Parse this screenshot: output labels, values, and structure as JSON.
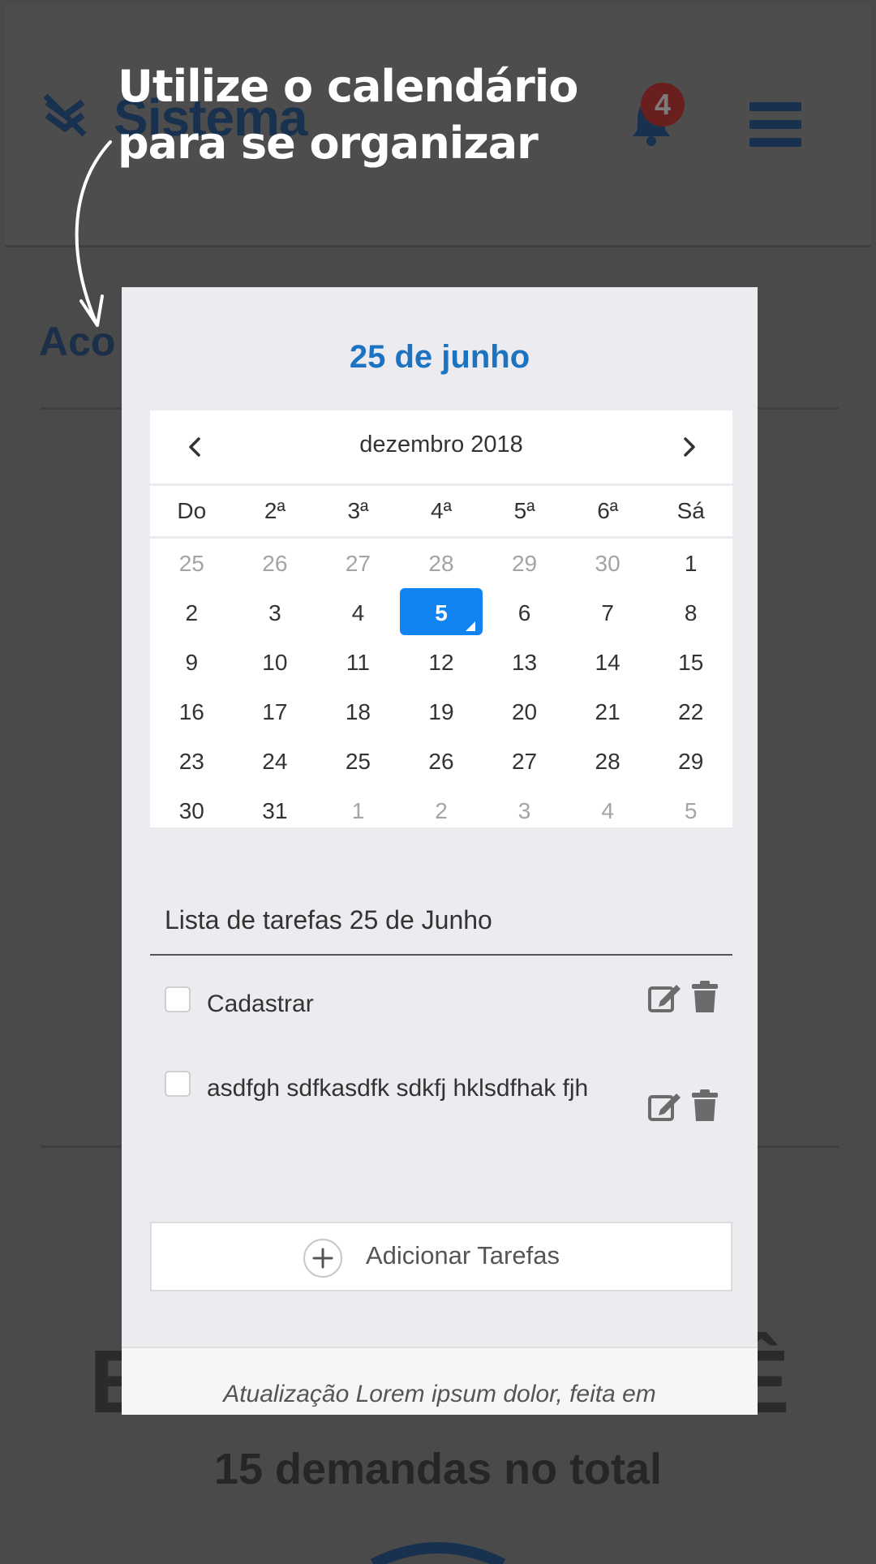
{
  "annotation": {
    "text": "Utilize o calendário para se organizar"
  },
  "background": {
    "logo_text": "Sistema",
    "notification_count": "4",
    "heading": "Aco",
    "big_left": "E",
    "big_right": "Ê",
    "total_text": "15 demandas no total"
  },
  "modal": {
    "title": "25 de junho",
    "calendar": {
      "month_label": "dezembro 2018",
      "weekdays": [
        "Do",
        "2ª",
        "3ª",
        "4ª",
        "5ª",
        "6ª",
        "Sá"
      ],
      "days": [
        "25",
        "26",
        "27",
        "28",
        "29",
        "30",
        "1",
        "2",
        "3",
        "4",
        "5",
        "6",
        "7",
        "8",
        "9",
        "10",
        "11",
        "12",
        "13",
        "14",
        "15",
        "16",
        "17",
        "18",
        "19",
        "20",
        "21",
        "22",
        "23",
        "24",
        "25",
        "26",
        "27",
        "28",
        "29",
        "30",
        "31",
        "1",
        "2",
        "3",
        "4",
        "5"
      ],
      "muted_days_count_start": 6,
      "selected_day": "5"
    },
    "tasks_title": "Lista de tarefas 25 de Junho",
    "tasks": [
      {
        "text": "Cadastrar"
      },
      {
        "text": "asdfgh sdfkasdfk sdkfj hklsdfhak fjh"
      }
    ],
    "add_label": "Adicionar Tarefas",
    "footer_text": "Atualização Lorem ipsum dolor, feita em"
  },
  "colors": {
    "accent": "#1284f2",
    "title_blue": "#1b73c2",
    "overlay": "#4a4a4a"
  }
}
